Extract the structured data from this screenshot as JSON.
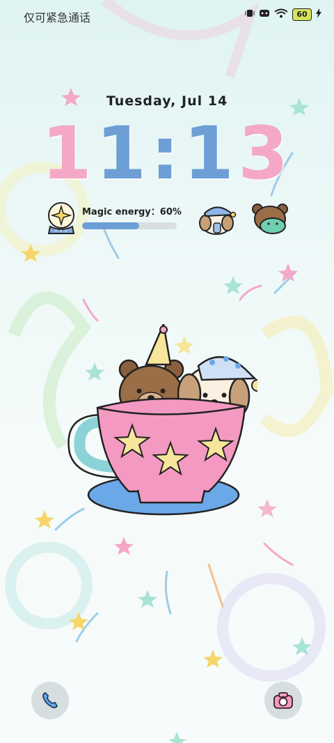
{
  "status_bar": {
    "carrier_text": "仅可紧急通话",
    "battery_level": "60",
    "icons": [
      "vibrate-icon",
      "notification-icon",
      "wifi-icon",
      "battery-icon",
      "charging-icon"
    ]
  },
  "lockscreen": {
    "date": "Tuesday,  Jul 14",
    "clock": {
      "hour": "11",
      "separator": ":",
      "minute": "13"
    },
    "colors": {
      "pink": "#f4a8c6",
      "blue": "#6d9fd6"
    }
  },
  "energy_widget": {
    "label": "Magic energy：60%",
    "progress": 0.6
  },
  "pets": [
    "sleepy-puppy-icon",
    "bear-with-turtle-icon"
  ],
  "wallpaper": "teacup-bear-puppy-illustration",
  "shortcuts": {
    "left": "phone-icon",
    "right": "camera-icon"
  }
}
